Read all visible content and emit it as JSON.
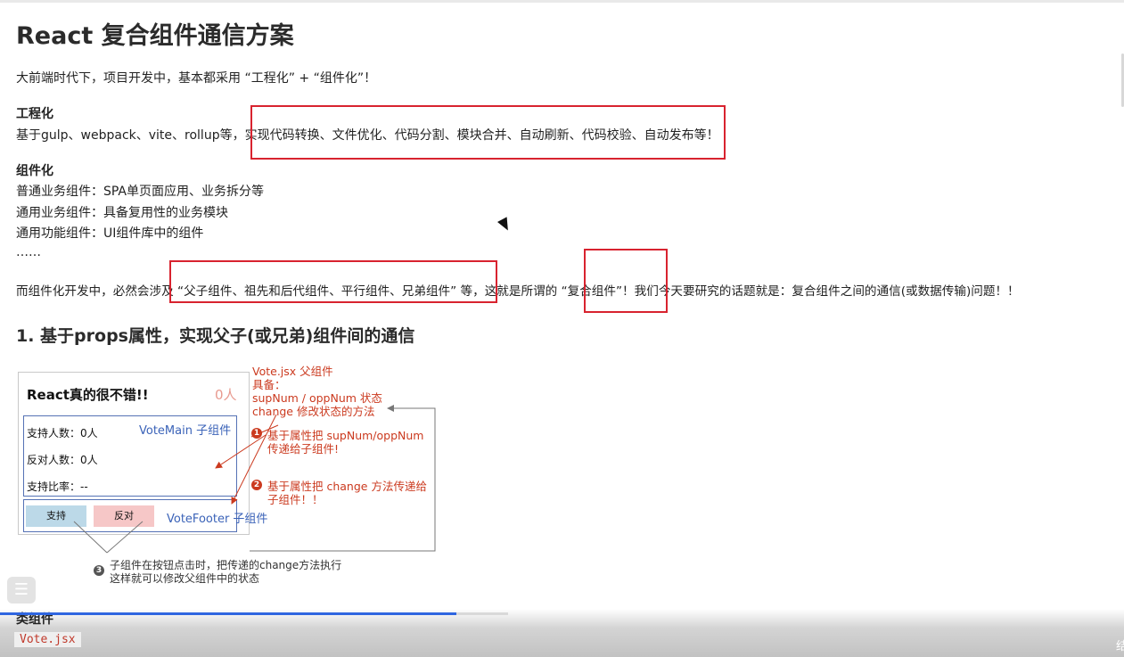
{
  "doc": {
    "title": "React 复合组件通信方案",
    "intro": "大前端时代下，项目开发中，基本都采用 “工程化” + “组件化”！",
    "eng_heading": "工程化",
    "eng_text": "基于gulp、webpack、vite、rollup等，实现代码转换、文件优化、代码分割、模块合并、自动刷新、代码校验、自动发布等！",
    "comp_heading": "组件化",
    "comp_items": [
      "普通业务组件：SPA单页面应用、业务拆分等",
      "通用业务组件：具备复用性的业务模块",
      "通用功能组件：UI组件库中的组件",
      "……"
    ],
    "summary": "而组件化开发中，必然会涉及 “父子组件、祖先和后代组件、平行组件、兄弟组件” 等，这就是所谓的 “复合组件”！我们今天要研究的话题就是：复合组件之间的通信(或数据传输)问题！！",
    "section1_heading": "1. 基于props属性，实现父子(或兄弟)组件间的通信",
    "cut_heading": "类组件",
    "code_file": "Vote.jsx"
  },
  "diagram": {
    "panel_title": "React真的很不错!!",
    "panel_count": "0人",
    "main_label": "VoteMain 子组件",
    "row_support": "支持人数：0人",
    "row_oppose": "反对人数：0人",
    "row_ratio": "支持比率：--",
    "btn_support": "支持",
    "btn_oppose": "反对",
    "footer_label": "VoteFooter 子组件",
    "parent_lines": [
      "Vote.jsx 父组件",
      "具备：",
      "supNum / oppNum 状态",
      "change 修改状态的方法"
    ],
    "step1_lines": [
      "基于属性把 supNum/oppNum",
      "传递给子组件!"
    ],
    "step2_lines": [
      "基于属性把 change 方法传递给",
      "子组件！！"
    ],
    "step3_lines": [
      "子组件在按钮点击时，把传递的change方法执行",
      "这样就可以修改父组件中的状态"
    ],
    "step_numbers": [
      "1",
      "2",
      "3"
    ]
  },
  "colors": {
    "annotation_box": "#d8232f",
    "diagram_red": "#cb3a1f",
    "diagram_blue": "#3b63b8",
    "progress": "#2f66e0"
  },
  "player": {
    "progress_fraction": 0.9,
    "toc_icon": "list-icon",
    "corner_text": "结"
  }
}
